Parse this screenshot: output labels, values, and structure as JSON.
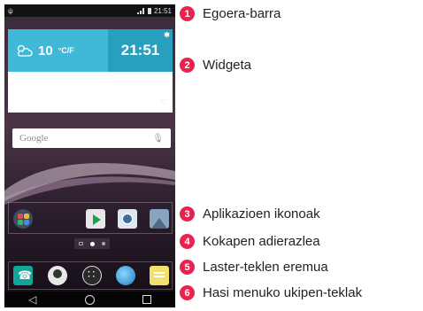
{
  "phone": {
    "status_time": "21:51",
    "weather": {
      "temp": "10",
      "unit": "°C/F",
      "icon": "partly-cloudy-icon"
    },
    "clock": "21:51",
    "search": {
      "logo": "Google"
    },
    "app_icons": [
      "app-folder-icon",
      "play-store-icon",
      "camera-icon",
      "gallery-icon"
    ],
    "hotkeys": [
      "phone-icon",
      "contacts-icon",
      "apps-drawer-icon",
      "browser-icon",
      "messages-icon"
    ],
    "nav": {
      "back": "◁"
    }
  },
  "callouts": [
    {
      "number": "1",
      "label": "Egoera-barra"
    },
    {
      "number": "2",
      "label": "Widgeta"
    },
    {
      "number": "3",
      "label": "Aplikazioen ikonoak"
    },
    {
      "number": "4",
      "label": "Kokapen adierazlea"
    },
    {
      "number": "5",
      "label": "Laster-teklen eremua"
    },
    {
      "number": "6",
      "label": "Hasi menuko ukipen-teklak"
    }
  ],
  "colors": {
    "callout_badge": "#e8244e",
    "widget_weather": "#3fb9d7",
    "widget_clock": "#299fbf"
  }
}
